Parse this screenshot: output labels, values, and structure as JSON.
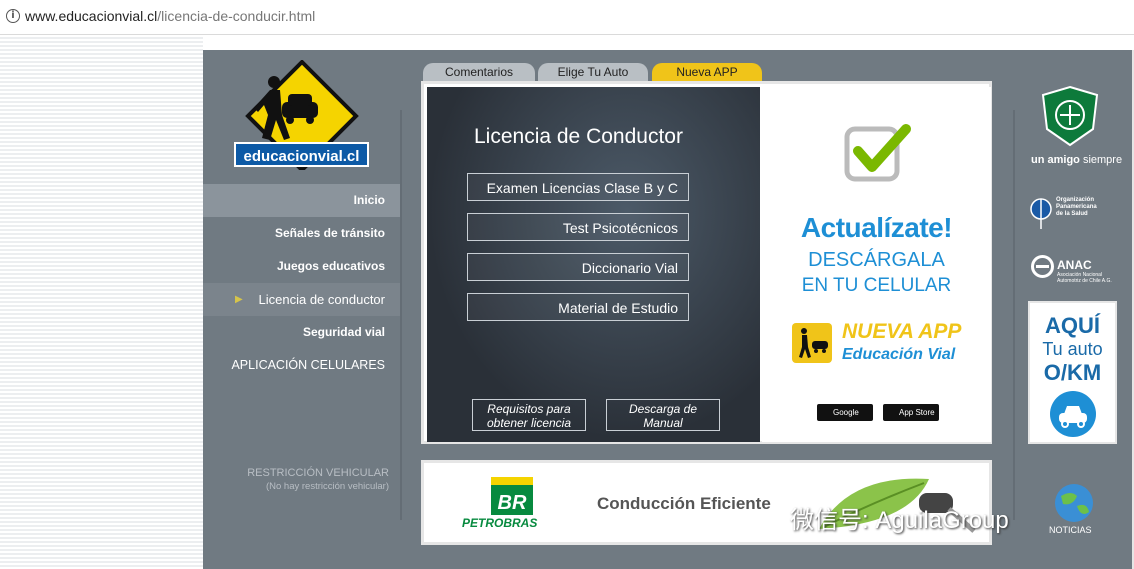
{
  "browser": {
    "url_host": "www.educacionvial.cl",
    "url_path": "/licencia-de-conducir.html"
  },
  "logo": {
    "text": "educacionvial.cl"
  },
  "nav": {
    "items": [
      {
        "label": "Inicio"
      },
      {
        "label": "Señales de tránsito"
      },
      {
        "label": "Juegos educativos"
      },
      {
        "label": "Licencia de conductor"
      },
      {
        "label": "Seguridad vial"
      },
      {
        "label": "APLICACIÓN CELULARES"
      }
    ]
  },
  "restriction": {
    "title": "RESTRICCIÓN VEHICULAR",
    "subtitle": "(No hay restricción vehicular)"
  },
  "tabs": [
    {
      "label": "Comentarios"
    },
    {
      "label": "Elige Tu Auto"
    },
    {
      "label": "Nueva APP"
    }
  ],
  "main": {
    "title": "Licencia de Conductor",
    "menu": [
      {
        "label": "Examen Licencias Clase B y C"
      },
      {
        "label": "Test Psicotécnicos"
      },
      {
        "label": "Diccionario Vial"
      },
      {
        "label": "Material de Estudio"
      }
    ],
    "buttons": [
      {
        "label_1": "Requisitos para",
        "label_2": "obtener licencia"
      },
      {
        "label_1": "Descarga de",
        "label_2": "Manual"
      }
    ]
  },
  "ad": {
    "headline": "Actualízate!",
    "line1": "DESCÁRGALA",
    "line2": "EN TU CELULAR",
    "app_line1": "NUEVA APP",
    "app_line2": "Educación Vial",
    "google_play": "Google Play",
    "app_store": "App Store"
  },
  "banner": {
    "brand": "PETROBRAS",
    "text": "Conducción Eficiente"
  },
  "right": {
    "carabineros_text": "un amigo",
    "carabineros_text2": "siempre",
    "ops_line1": "Organización",
    "ops_line2": "Panamericana",
    "ops_line3": "de la Salud",
    "anac": "ANAC",
    "anac_sub1": "Asociación Nacional",
    "anac_sub2": "Automotriz de Chile A.G.",
    "aqui_1": "AQUÍ",
    "aqui_2": "Tu auto",
    "aqui_3": "O/KM",
    "news": "NOTICIAS"
  },
  "watermark": "微信号: AguilaGroup",
  "colors": {
    "site_bg": "#707a82",
    "accent_yellow": "#f0c419",
    "brand_blue": "#0d5aa6",
    "ad_blue": "#1e8fd5"
  }
}
